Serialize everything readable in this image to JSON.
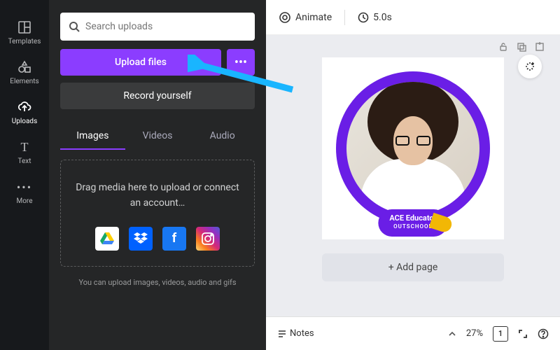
{
  "rail": {
    "templates": "Templates",
    "elements": "Elements",
    "uploads": "Uploads",
    "text": "Text",
    "more": "More"
  },
  "panel": {
    "search_placeholder": "Search uploads",
    "upload_label": "Upload files",
    "upload_more": "•••",
    "record_label": "Record yourself",
    "tabs": {
      "images": "Images",
      "videos": "Videos",
      "audio": "Audio"
    },
    "dropzone_text": "Drag media here to upload or connect an account…",
    "hint": "You can upload images, videos, audio and gifs"
  },
  "topbar": {
    "animate": "Animate",
    "duration": "5.0s"
  },
  "stage": {
    "badge_title": "ACE Educator",
    "badge_sub": "OUTSCHOOL",
    "add_page": "+ Add page"
  },
  "bottombar": {
    "notes": "Notes",
    "zoom": "27%",
    "page_number": "1"
  },
  "colors": {
    "accent": "#8b3dff",
    "ring": "#6a1ee6",
    "annotation": "#19b5ff"
  }
}
